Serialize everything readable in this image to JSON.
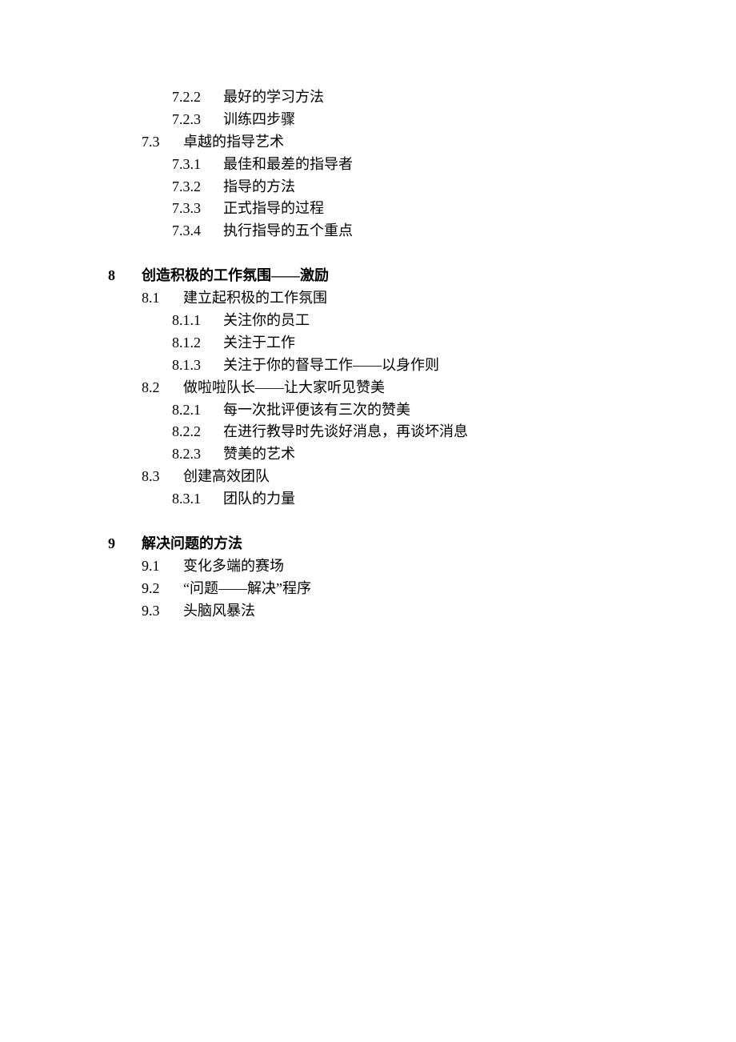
{
  "toc": [
    {
      "level": 3,
      "num": "7.2.2",
      "title": "最好的学习方法"
    },
    {
      "level": 3,
      "num": "7.2.3",
      "title": "训练四步骤"
    },
    {
      "level": 2,
      "num": "7.3",
      "title": "卓越的指导艺术"
    },
    {
      "level": 3,
      "num": "7.3.1",
      "title": "最佳和最差的指导者"
    },
    {
      "level": 3,
      "num": "7.3.2",
      "title": "指导的方法"
    },
    {
      "level": 3,
      "num": "7.3.3",
      "title": "正式指导的过程"
    },
    {
      "level": 3,
      "num": "7.3.4",
      "title": "执行指导的五个重点"
    },
    {
      "level": 1,
      "num": "8",
      "title": "创造积极的工作氛围——激励"
    },
    {
      "level": 2,
      "num": "8.1",
      "title": "建立起积极的工作氛围"
    },
    {
      "level": 3,
      "num": "8.1.1",
      "title": "关注你的员工"
    },
    {
      "level": 3,
      "num": "8.1.2",
      "title": "关注于工作"
    },
    {
      "level": 3,
      "num": "8.1.3",
      "title": "关注于你的督导工作——以身作则"
    },
    {
      "level": 2,
      "num": "8.2",
      "title": "做啦啦队长——让大家听见赞美"
    },
    {
      "level": 3,
      "num": "8.2.1",
      "title": "每一次批评便该有三次的赞美"
    },
    {
      "level": 3,
      "num": "8.2.2",
      "title": "在进行教导时先谈好消息，再谈坏消息"
    },
    {
      "level": 3,
      "num": "8.2.3",
      "title": "赞美的艺术"
    },
    {
      "level": 2,
      "num": "8.3",
      "title": "创建高效团队"
    },
    {
      "level": 3,
      "num": "8.3.1",
      "title": "团队的力量"
    },
    {
      "level": 1,
      "num": "9",
      "title": "解决问题的方法"
    },
    {
      "level": 2,
      "num": "9.1",
      "title": "变化多端的赛场"
    },
    {
      "level": 2,
      "num": "9.2",
      "title": "“问题——解决”程序"
    },
    {
      "level": 2,
      "num": "9.3",
      "title": "头脑风暴法"
    }
  ]
}
